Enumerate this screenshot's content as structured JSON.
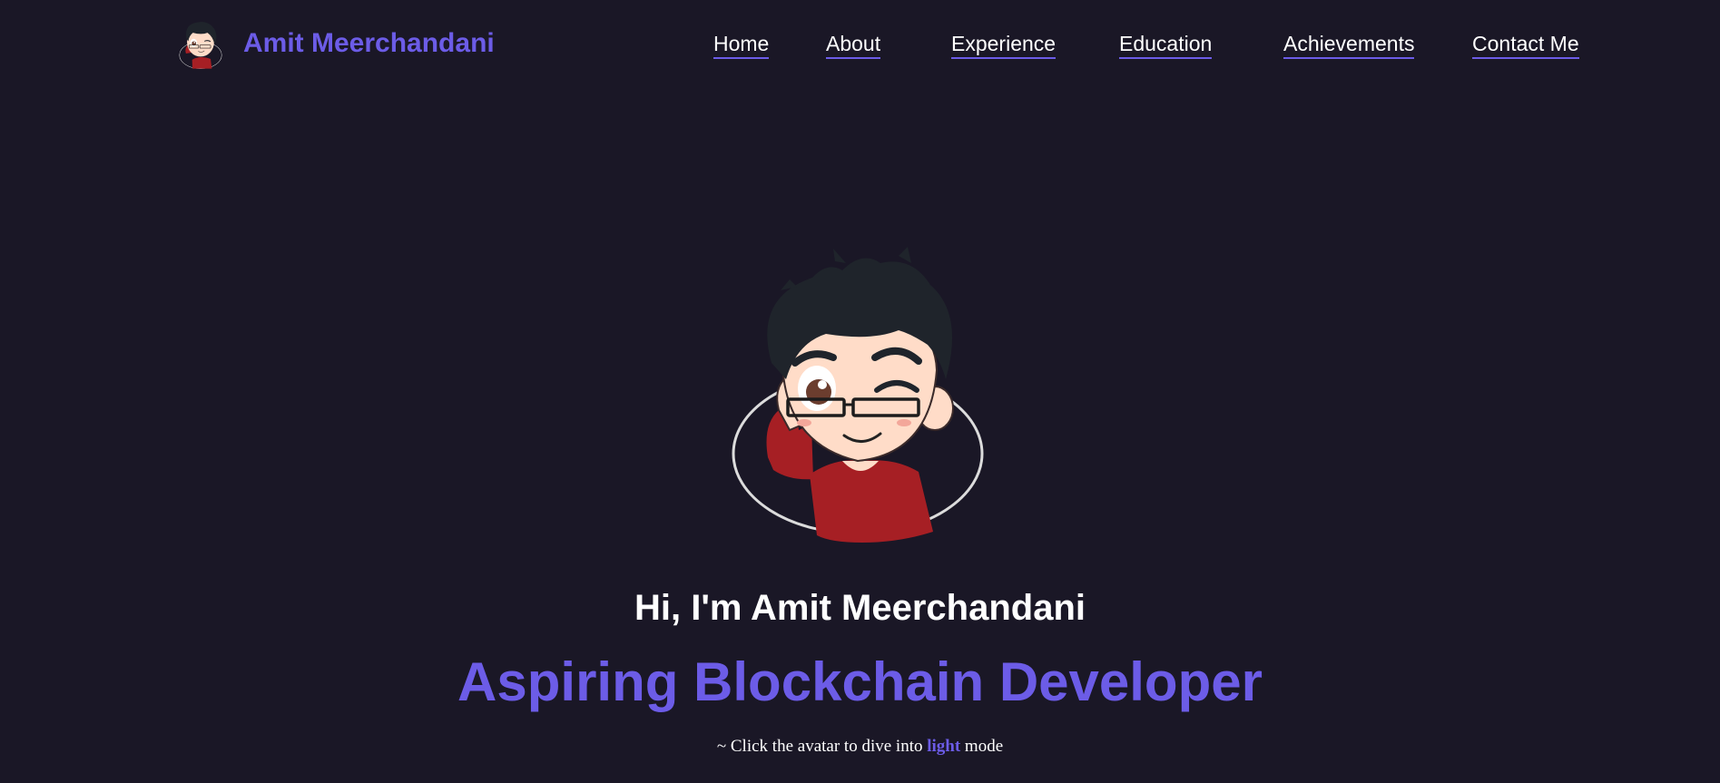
{
  "header": {
    "brand_name": "Amit Meerchandani",
    "brand_avatar_icon": "avatar-icon",
    "nav": [
      {
        "label": "Home"
      },
      {
        "label": "About"
      },
      {
        "label": "Experience"
      },
      {
        "label": "Education"
      },
      {
        "label": "Achievements"
      },
      {
        "label": "Contact Me"
      }
    ]
  },
  "hero": {
    "avatar_icon": "avatar-icon",
    "greeting": "Hi, I'm Amit Meerchandani",
    "role": "Aspiring Blockchain Developer",
    "hint_prefix": "~ Click the avatar to dive into ",
    "hint_mode": "light",
    "hint_suffix": " mode"
  },
  "colors": {
    "background": "#1a1726",
    "accent": "#6c5ce7",
    "text": "#ffffff"
  }
}
